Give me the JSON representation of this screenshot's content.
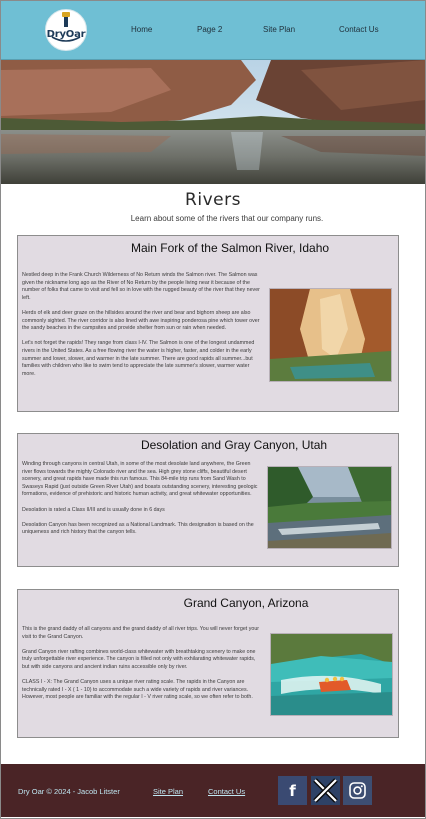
{
  "brand": {
    "logo_text": "DryOar"
  },
  "nav": {
    "home": "Home",
    "page2": "Page 2",
    "site_plan": "Site Plan",
    "contact": "Contact Us"
  },
  "page": {
    "title": "Rivers",
    "subtitle": "Learn about some of the rivers that our company runs."
  },
  "rivers": [
    {
      "title": "Main Fork of the Salmon River, Idaho",
      "paragraphs": [
        "Nestled deep in the Frank Church Wilderness of No Return winds the Salmon river. The Salmon was given the nickname long ago as the River of No Return by the people living near it because of the number of folks that came to visit and fell so in love with the rugged beauty of the river that they never left.",
        "Herds of elk and deer graze on the hillsides around the river and bear and bighorn sheep are also commonly sighted. The river corridor is also lined with awe inspiring ponderosa pine which tower over the sandy beaches in the campsites and provide shelter from sun or rain when needed.",
        "Let's not forget the rapids! They range from class I-IV. The Salmon is one of the longest undammed rivers in the United States. As a free flowing river the water is higher, faster, and colder in the early summer and lower, slower, and warmer in the late summer. There are good rapids all summer...but families with children who like to swim tend to appreciate the late summer's slower, warmer water more."
      ]
    },
    {
      "title": "Desolation and Gray Canyon, Utah",
      "paragraphs": [
        "Winding through canyons in central Utah, in some of the most desolate land anywhere, the Green river flows towards the mighty Colorado river and the sea. High grey stone cliffs, beautiful desert scenery, and great rapids have made this run famous. This 84-mile trip runs from Sand Wash to Swaseys Rapid (just outside Green River Utah) and boasts outstanding scenery, interesting geologic formations, evidence of prehistoric and historic human activity, and great whitewater opportunities.",
        "Desolation is rated a Class II/III and is usually done in 6 days",
        "Desolation Canyon has been recognized as a National Landmark.  This designation is based on the uniqueness and rich history that the canyon tells."
      ]
    },
    {
      "title": "Grand Canyon, Arizona",
      "paragraphs": [
        "This is the grand daddy of all canyons and the grand daddy of all river trips. You will never forget your visit to the Grand Canyon.",
        "Grand Canyon river rafting combines world-class whitewater with breathtaking scenery to make one truly unforgettable river experience. The canyon is filled not only with exhilarating whitewater rapids, but with side canyons and ancient indian ruins accessible only by river.",
        "CLASS I - X: The Grand Canyon uses a unique river rating scale. The rapids in the Canyon are technically rated I - X ( 1 - 10) to accommodate such a wide variety of rapids and river variances. However, most people are familiar with the regular I - V river rating scale, so we often refer to both."
      ]
    }
  ],
  "footer": {
    "copyright": "Dry Oar © 2024 - Jacob Litster",
    "site_plan": "Site Plan",
    "contact": "Contact Us"
  },
  "social": {
    "facebook_icon": "f",
    "x_icon": "X",
    "instagram_icon": "instagram-icon"
  },
  "colors": {
    "header": "#6fbfd4",
    "card": "#e1dbe2",
    "footer": "#4a2426",
    "footer_text": "#bfe6f1"
  }
}
